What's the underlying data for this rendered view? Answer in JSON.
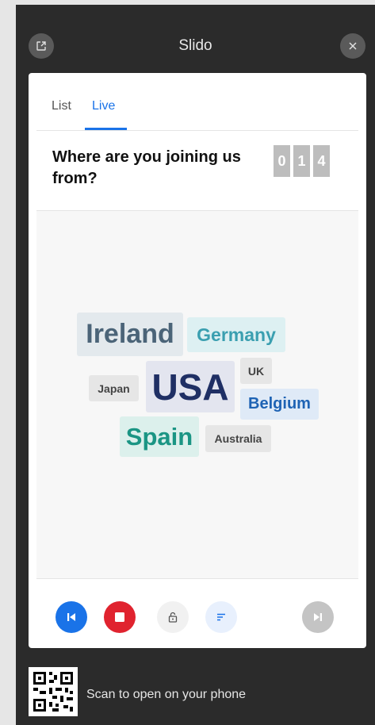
{
  "header": {
    "title": "Slido"
  },
  "tabs": [
    {
      "label": "List"
    },
    {
      "label": "Live"
    }
  ],
  "question": {
    "text": "Where are you joining us from?",
    "count_digits": [
      "0",
      "1",
      "4"
    ]
  },
  "word_cloud": [
    {
      "word": "Ireland",
      "color": "#4b6478",
      "bg": "#e3e9ed"
    },
    {
      "word": "Germany",
      "color": "#3a9fb0",
      "bg": "#ddf0f2"
    },
    {
      "word": "UK",
      "color": "#444444",
      "bg": "#e6e6e6"
    },
    {
      "word": "Japan",
      "color": "#444444",
      "bg": "#e6e6e6"
    },
    {
      "word": "USA",
      "color": "#1f2f64",
      "bg": "#e3e5ef"
    },
    {
      "word": "Belgium",
      "color": "#1e63b4",
      "bg": "#dfeaf7"
    },
    {
      "word": "Spain",
      "color": "#1b9584",
      "bg": "#dcf0ec"
    },
    {
      "word": "Australia",
      "color": "#444444",
      "bg": "#e6e6e6"
    }
  ],
  "footer": {
    "scan_text": "Scan to open on your phone"
  },
  "colors": {
    "accent": "#1a73e8",
    "stop": "#e0232f",
    "disabled": "#c4c4c4"
  }
}
